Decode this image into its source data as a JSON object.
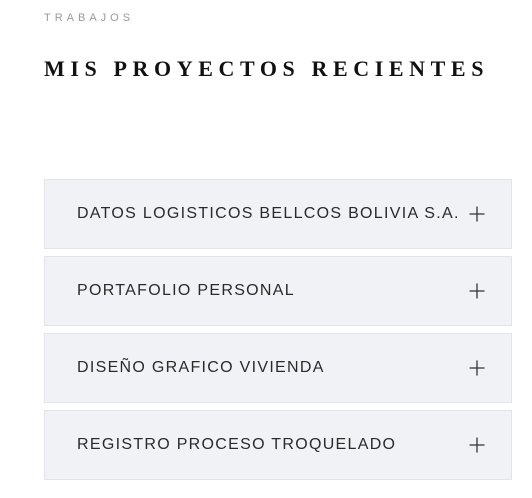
{
  "section": {
    "eyebrow": "TRABAJOS",
    "title": "MIS PROYECTOS RECIENTES"
  },
  "projects": [
    {
      "label": "DATOS LOGISTICOS BELLCOS BOLIVIA S.A.",
      "icon": "plus-icon"
    },
    {
      "label": "PORTAFOLIO PERSONAL",
      "icon": "plus-icon"
    },
    {
      "label": "DISEÑO GRAFICO VIVIENDA",
      "icon": "plus-icon"
    },
    {
      "label": "REGISTRO PROCESO TROQUELADO",
      "icon": "plus-icon"
    }
  ],
  "colors": {
    "item_background": "#f1f2f6",
    "text": "#2a2a2a",
    "eyebrow": "#9a9a9a"
  }
}
